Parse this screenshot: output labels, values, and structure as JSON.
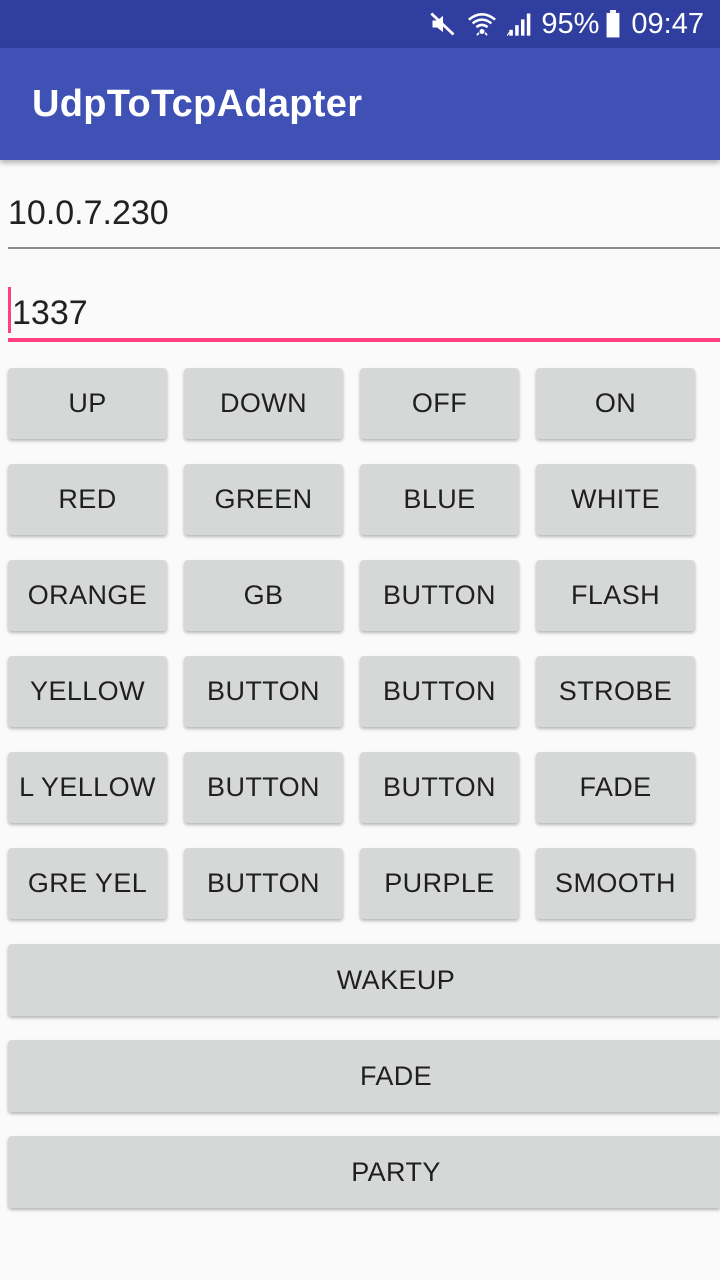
{
  "status_bar": {
    "battery": "95%",
    "time": "09:47",
    "icons": [
      "mute-icon",
      "wifi-icon",
      "signal-icon",
      "battery-icon"
    ]
  },
  "app_bar": {
    "title": "UdpToTcpAdapter"
  },
  "fields": {
    "ip": {
      "value": "10.0.7.230"
    },
    "port": {
      "value": "1337"
    }
  },
  "grid": {
    "row1": [
      "UP",
      "DOWN",
      "OFF",
      "ON"
    ],
    "row2": [
      "RED",
      "GREEN",
      "BLUE",
      "WHITE"
    ],
    "row3": [
      "ORANGE",
      "GB",
      "BUTTON",
      "FLASH"
    ],
    "row4": [
      "YELLOW",
      "BUTTON",
      "BUTTON",
      "STROBE"
    ],
    "row5": [
      "L YELLOW",
      "BUTTON",
      "BUTTON",
      "FADE"
    ],
    "row6": [
      "GRE YEL",
      "BUTTON",
      "PURPLE",
      "SMOOTH"
    ]
  },
  "wide_buttons": {
    "wakeup": "WAKEUP",
    "fade": "FADE",
    "party": "PARTY"
  },
  "colors": {
    "status_bar": "#303f9f",
    "app_bar": "#3f51b5",
    "accent": "#ff4081",
    "button": "#d6d7d7",
    "background": "#fafafa"
  }
}
